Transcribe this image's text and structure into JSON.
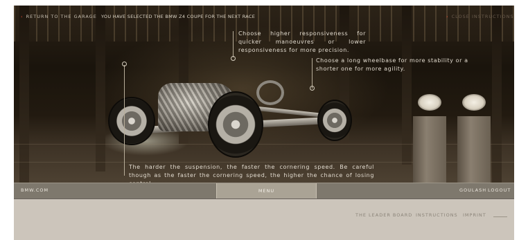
{
  "header": {
    "return_label": "RETURN TO THE GARAGE",
    "status_text": "YOU HAVE SELECTED THE BMW Z4 COUPE FOR THE NEXT RACE",
    "close_label": "CLOSE INSTRUCTIONS",
    "accent_color": "#d2472e"
  },
  "instructions": {
    "responsiveness": "Choose higher responsiveness for quicker manoeuvres or lower responsiveness for more precision.",
    "wheelbase": "Choose a long wheelbase for more stability or a shorter one for more agility.",
    "suspension": "The harder the suspension, the faster the cornering speed. Be careful though as the faster the cornering speed, the higher the chance of losing control."
  },
  "navbar": {
    "site_link": "BMW.COM",
    "menu_label": "MENU",
    "username": "GOULASH",
    "logout_label": "LOGOUT"
  },
  "footer": {
    "links": [
      "THE LEADER BOARD",
      "INSTRUCTIONS",
      "IMPRINT"
    ]
  }
}
